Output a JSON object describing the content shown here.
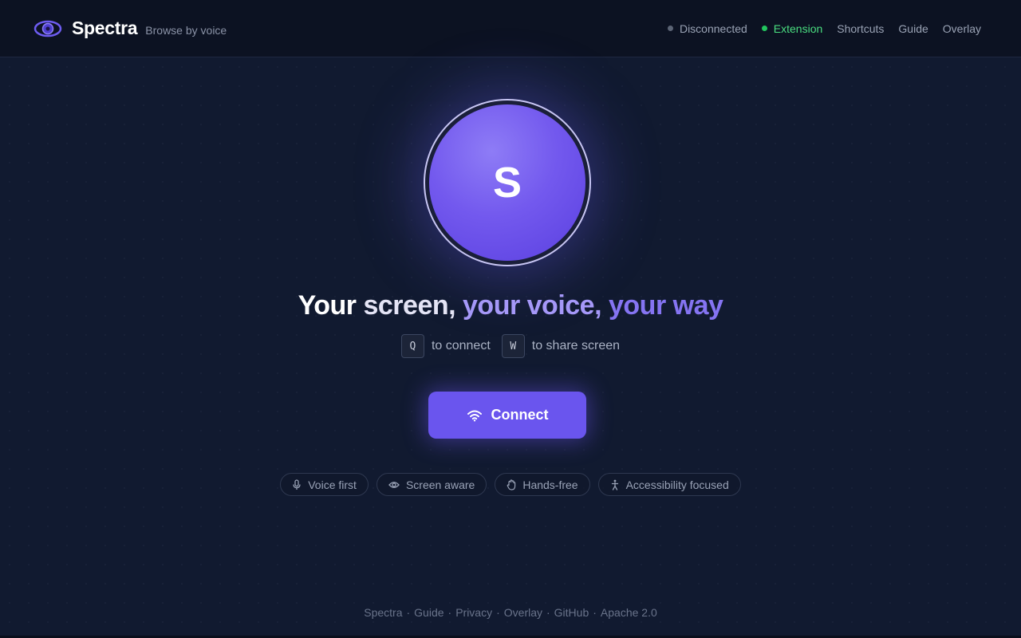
{
  "header": {
    "brand": "Spectra",
    "tagline": "Browse by voice",
    "status_label": "Disconnected",
    "status_color": "#5b6475",
    "extension_label": "Extension",
    "extension_color": "#22c55e",
    "nav": [
      "Shortcuts",
      "Guide",
      "Overlay"
    ]
  },
  "orb": {
    "letter": "S"
  },
  "headline": {
    "part1": "Your ",
    "part2": "screen,",
    "part3": " your voice,",
    "part4": " your way"
  },
  "shortcuts": {
    "key1": "Q",
    "text1": "to connect",
    "key2": "W",
    "text2": "to share screen"
  },
  "connect_button": {
    "label": "Connect",
    "icon": "wifi-icon",
    "color": "#6a55ee"
  },
  "features": [
    {
      "label": "Voice first",
      "icon": "microphone-icon"
    },
    {
      "label": "Screen aware",
      "icon": "eye-icon"
    },
    {
      "label": "Hands-free",
      "icon": "hand-icon"
    },
    {
      "label": "Accessibility focused",
      "icon": "accessibility-icon"
    }
  ],
  "footer": {
    "links": [
      "Spectra",
      "Guide",
      "Privacy",
      "Overlay",
      "GitHub",
      "Apache 2.0"
    ],
    "separator": "·"
  }
}
